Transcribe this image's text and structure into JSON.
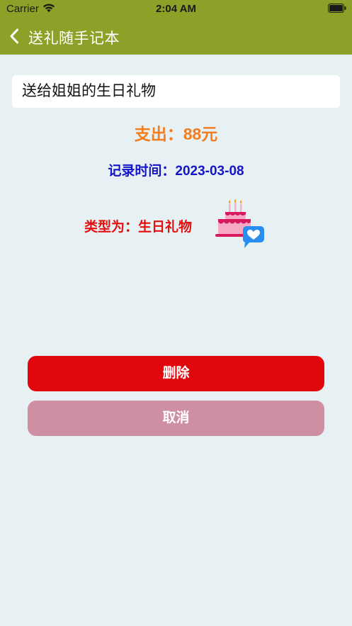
{
  "status_bar": {
    "carrier": "Carrier",
    "time": "2:04 AM"
  },
  "nav": {
    "title": "送礼随手记本",
    "back_icon": "chevron-left-icon"
  },
  "record": {
    "title": "送给姐姐的生日礼物",
    "amount": "支出：88元",
    "time": "记录时间：2023-03-08",
    "type": "类型为：生日礼物",
    "type_icon": "birthday-cake-icon"
  },
  "actions": {
    "delete_label": "删除",
    "cancel_label": "取消"
  },
  "colors": {
    "nav_bg": "#8ea027",
    "page_bg": "#e7f1f4",
    "amount": "#f47d20",
    "time": "#1515c7",
    "type": "#e30f0f",
    "delete_btn": "#e0080c",
    "cancel_btn": "#cf8fa2"
  }
}
